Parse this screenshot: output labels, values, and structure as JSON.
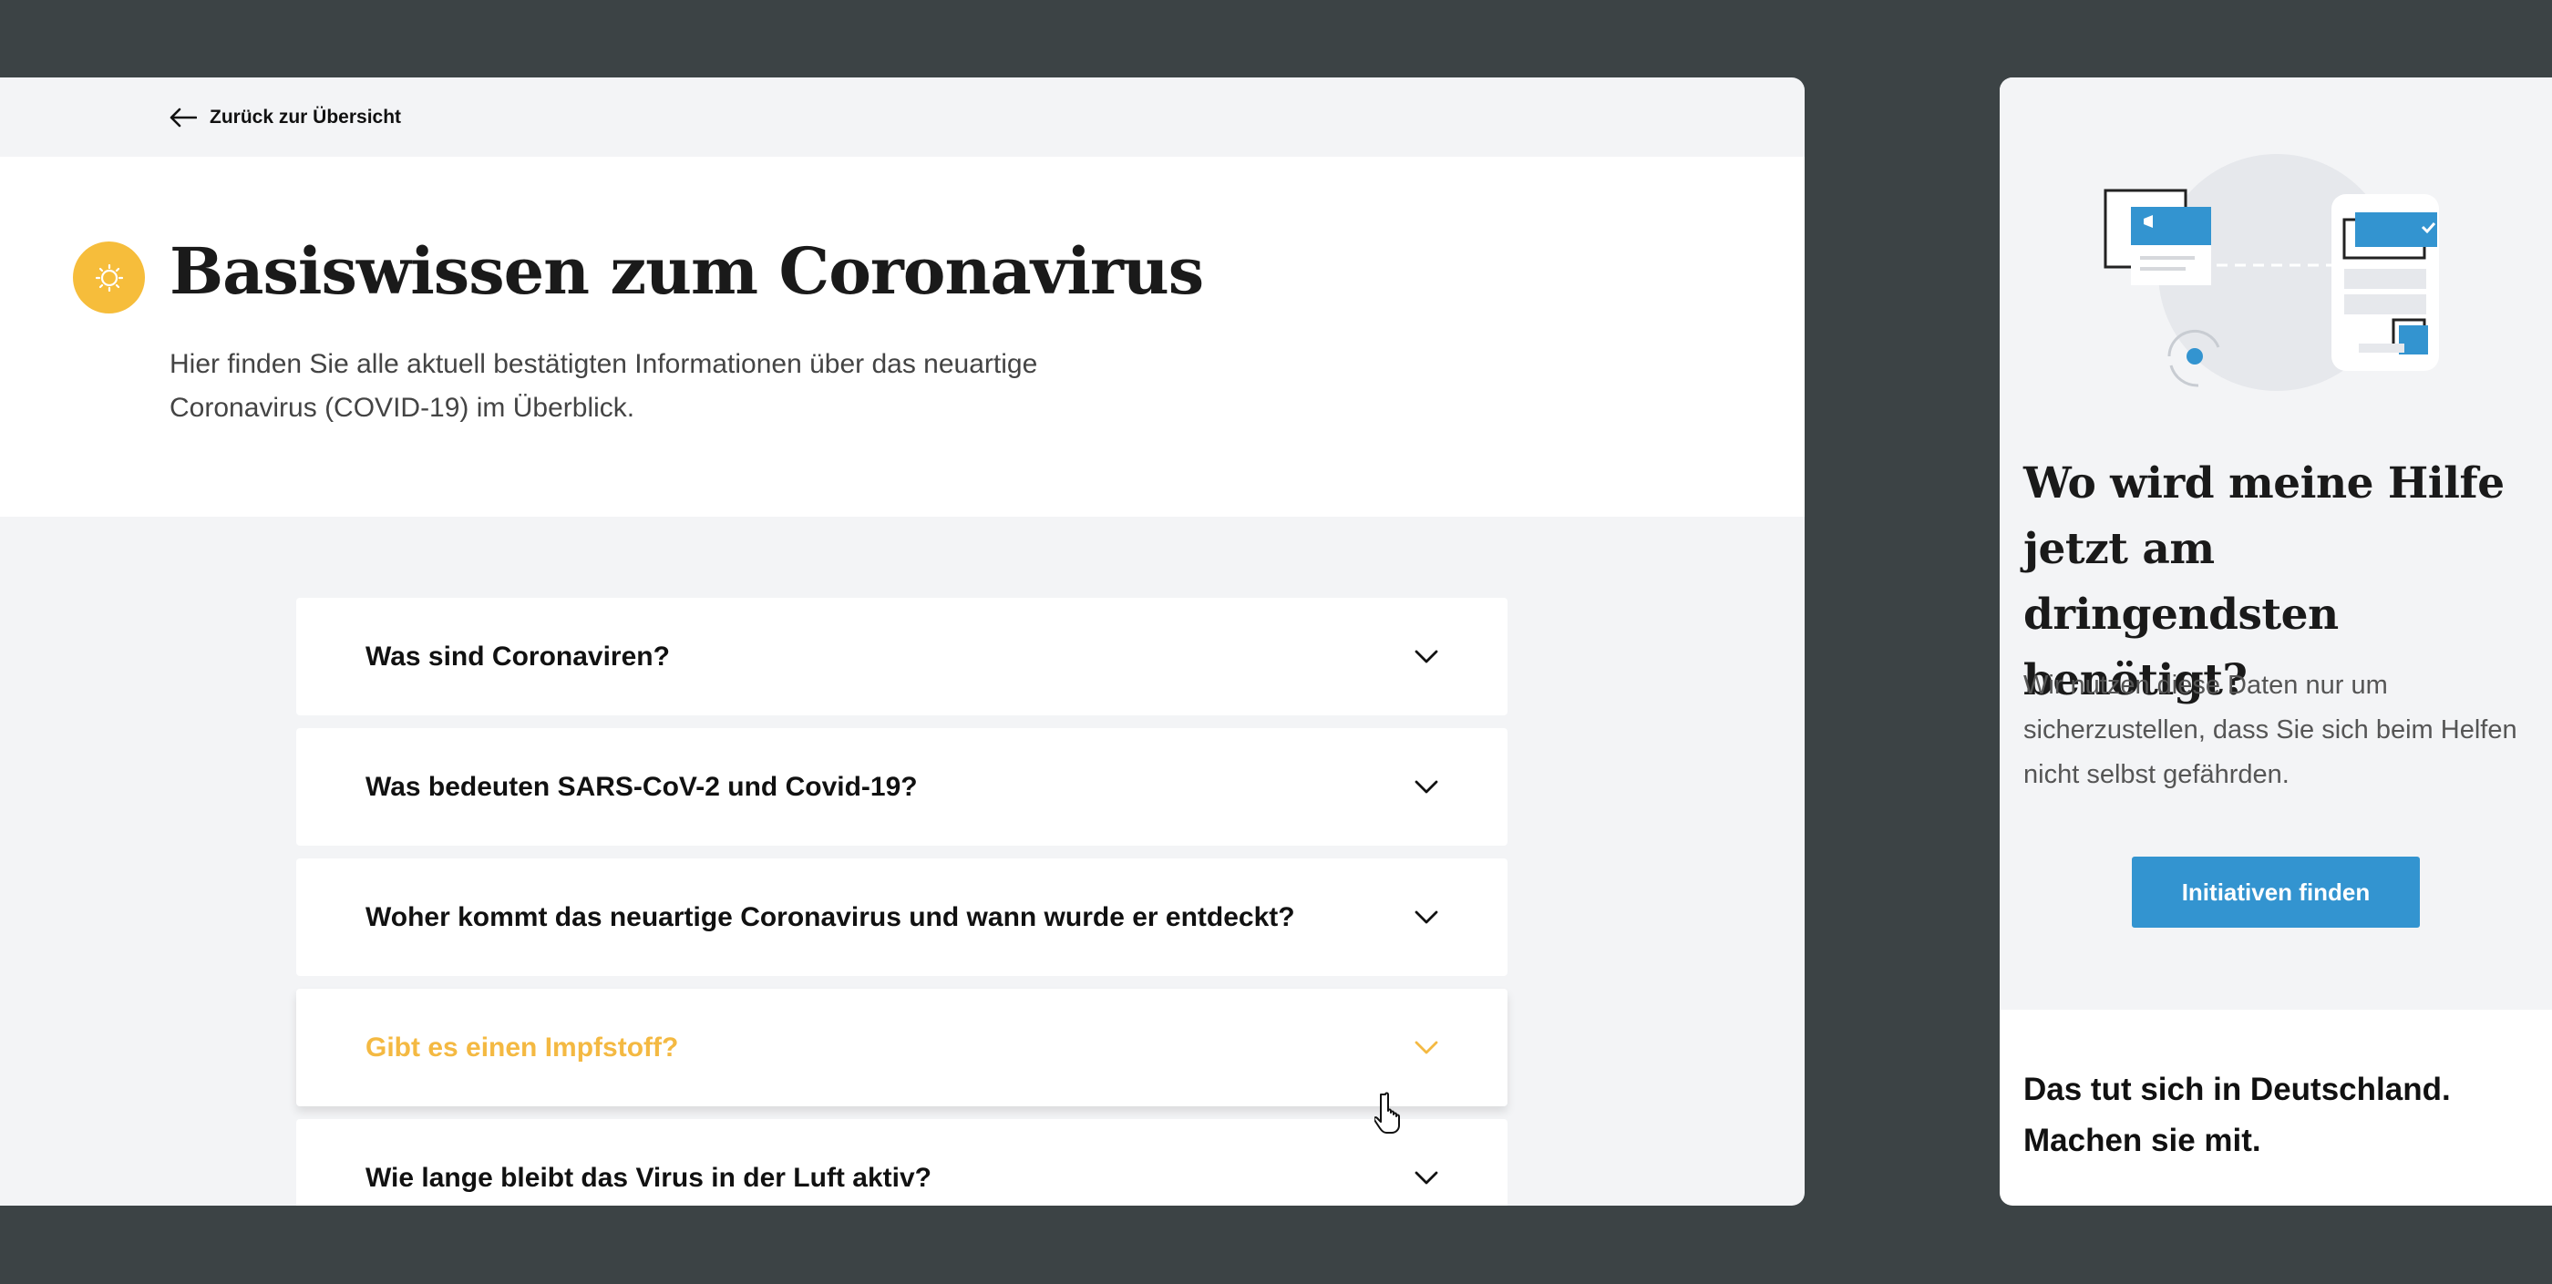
{
  "header": {
    "back_label": "Zurück zur Übersicht"
  },
  "hero": {
    "title": "Basiswissen zum Coronavirus",
    "description": "Hier finden Sie alle aktuell bestätigten Informationen über das neuartige Coronavirus (COVID-19) im Überblick.",
    "icon": "sun-icon",
    "icon_color": "#f6bd3b"
  },
  "faq": {
    "items": [
      {
        "question": "Was sind Coronaviren?"
      },
      {
        "question": "Was bedeuten SARS-CoV-2 und Covid-19?"
      },
      {
        "question": "Woher kommt das neuartige Coronavirus und wann wurde er entdeckt?"
      },
      {
        "question": "Gibt es einen Impfstoff?"
      },
      {
        "question": "Wie lange bleibt das Virus in der Luft aktiv?"
      }
    ],
    "hover_color": "#f4b942"
  },
  "sidebar": {
    "title": "Wo wird meine Hilfe jetzt am dringendsten benötigt?",
    "text": "Wir nutzen diese Daten nur um sicherzustellen, dass Sie sich beim Helfen nicht selbst gefährden.",
    "cta_label": "Initiativen finden",
    "cta_color": "#3394d0",
    "bottom_text": "Das tut sich in Deutschland. Machen sie mit."
  }
}
